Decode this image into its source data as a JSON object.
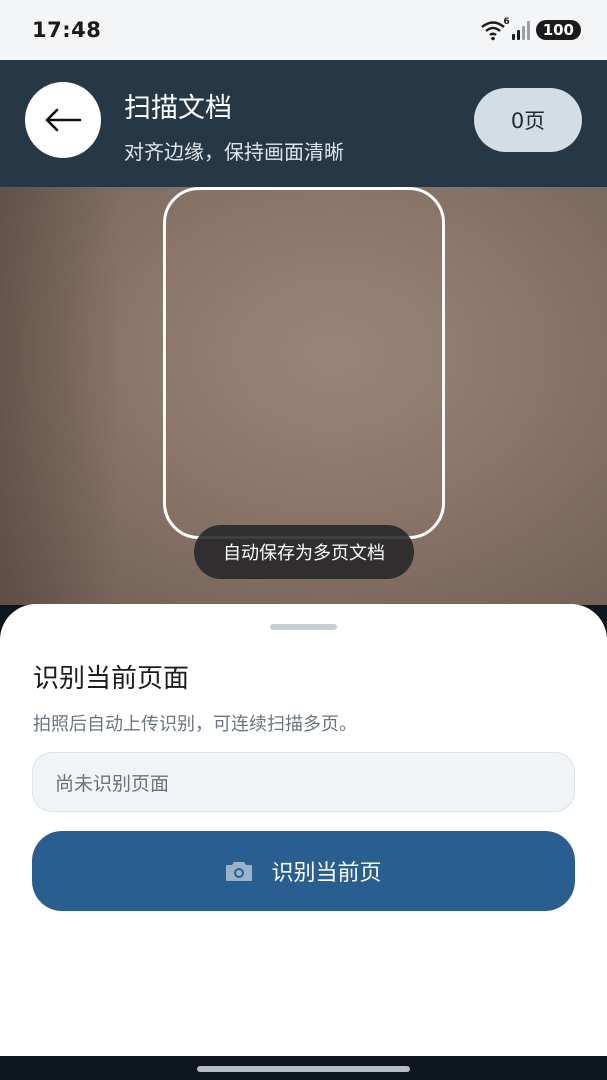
{
  "status_bar": {
    "time": "17:48",
    "wifi_badge": "6",
    "battery": "100",
    "icons": [
      "wifi-icon",
      "signal-icon",
      "battery-icon"
    ]
  },
  "header": {
    "title": "扫描文档",
    "subtitle": "对齐边缘，保持画面清晰",
    "page_count": "0页",
    "back_icon": "arrow-left-icon"
  },
  "camera": {
    "hint": "自动保存为多页文档"
  },
  "sheet": {
    "title": "识别当前页面",
    "description": "拍照后自动上传识别，可连续扫描多页。",
    "result_placeholder": "尚未识别页面",
    "button_label": "识别当前页",
    "button_icon": "camera-icon"
  },
  "colors": {
    "header_bg": "#263846",
    "accent": "#285f90",
    "page_count_bg": "#d5dde4"
  }
}
